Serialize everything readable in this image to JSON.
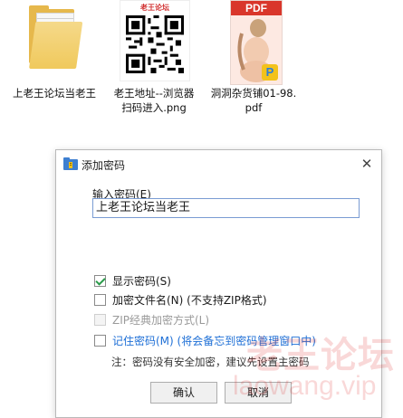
{
  "files": [
    {
      "name": "上老王论坛当老王",
      "icon": "folder-icon"
    },
    {
      "name": "老王地址--浏览器扫码进入.png",
      "icon": "qr-image-thumbnail",
      "thumb_title": "老王论坛"
    },
    {
      "name": "洞洞杂货铺01-98.pdf",
      "icon": "pdf-thumbnail",
      "thumb_tag": "PDF",
      "badge": "P"
    }
  ],
  "dialog": {
    "title": "添加密码",
    "password_label": "输入密码(E)",
    "password_value": "上老王论坛当老王",
    "options": {
      "show_password": {
        "label": "显示密码(S)",
        "checked": true
      },
      "encrypt_names": {
        "label": "加密文件名(N) (不支持ZIP格式)",
        "checked": false
      },
      "zip_classic": {
        "label": "ZIP经典加密方式(L)",
        "checked": false,
        "disabled": true
      },
      "remember": {
        "label": "记住密码(M) (将会备忘到密码管理窗口中)",
        "checked": false
      }
    },
    "note": "注：密码没有安全加密，建议先设置主密码",
    "ok_label": "确认",
    "cancel_label": "取消"
  },
  "watermark": {
    "cn": "老王论坛",
    "en": "laowang.vip"
  },
  "colors": {
    "link": "#1e6fd6",
    "check": "#2a9b4a",
    "pdf_red": "#d9362b",
    "folder": "#f0c95c"
  }
}
